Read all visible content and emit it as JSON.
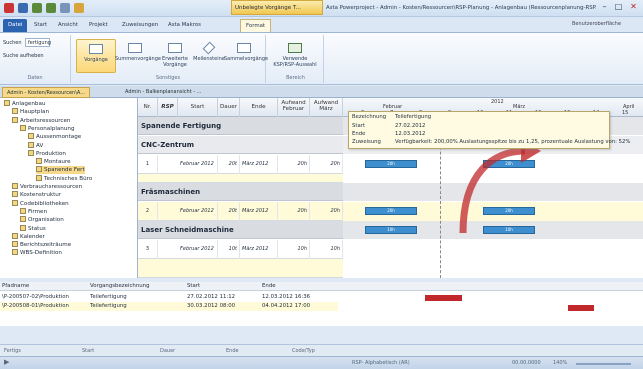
{
  "titlebar": {
    "context_label": "Unbelegte Vorgänge T...",
    "window_title": "Asta Powerproject - Admin - Kosten/Ressourcen\\RSP-Planung - Anlagenbau (Ressourcenplanung-RSP.pp) \\P..."
  },
  "tabs": [
    "Datei",
    "Start",
    "Ansicht",
    "Projekt",
    "Zuweisungen",
    "Asta Makros",
    "Format"
  ],
  "help_label": "Benutzeroberfläche",
  "ribbon": {
    "daten": {
      "search_label": "Suchen",
      "search_value": "fertigung",
      "clear": "Suche aufheben",
      "group": "Daten"
    },
    "buttons": [
      {
        "label": "Vorgänge",
        "sel": true
      },
      {
        "label": "Summenvorgänge"
      },
      {
        "label": "Erweiterte Vorgänge"
      },
      {
        "label": "Meilensteine"
      },
      {
        "label": "Sammelvorgänge"
      }
    ],
    "sonstiges_label": "Sonstiges",
    "bereich": {
      "label": "Verwende KSP/RSP-Auswahl",
      "group": "Bereich"
    }
  },
  "doc_tabs": [
    {
      "label": "Admin - Kosten/Ressourcen\\A...",
      "active": true
    },
    {
      "label": "Admin - Balkenplanansicht - ..."
    }
  ],
  "tree": [
    {
      "label": "Anlagenbau",
      "lvl": 0
    },
    {
      "label": "Hauptplan",
      "lvl": 1
    },
    {
      "label": "Arbeitsressourcen",
      "lvl": 1
    },
    {
      "label": "Personalplanung",
      "lvl": 2
    },
    {
      "label": "Aussenmontage",
      "lvl": 3
    },
    {
      "label": "AV",
      "lvl": 3
    },
    {
      "label": "Produktion",
      "lvl": 3
    },
    {
      "label": "Montaure",
      "lvl": 4
    },
    {
      "label": "Spanende Fert",
      "lvl": 4,
      "sel": true
    },
    {
      "label": "Technisches Büro",
      "lvl": 4
    },
    {
      "label": "Verbrauchsressourcen",
      "lvl": 1
    },
    {
      "label": "Kostenstruktur",
      "lvl": 1
    },
    {
      "label": "Codebibliotheken",
      "lvl": 1
    },
    {
      "label": "Firmen",
      "lvl": 2
    },
    {
      "label": "Organisation",
      "lvl": 2
    },
    {
      "label": "Status",
      "lvl": 2
    },
    {
      "label": "Kalender",
      "lvl": 1
    },
    {
      "label": "Berichtszeiträume",
      "lvl": 1
    },
    {
      "label": "WBS-Definition",
      "lvl": 1
    }
  ],
  "grid": {
    "headers": [
      "Nr.",
      "RSP",
      "Start",
      "Dauer",
      "Ende",
      "Aufwand Februar",
      "Aufwand März"
    ],
    "bands": [
      "Spanende Fertigung",
      "CNC-Zentrum",
      "Fräsmaschinen",
      "Laser Schneidmaschine"
    ],
    "rows": [
      {
        "nr": "1",
        "start": "Februar 2012",
        "dauer": "20t",
        "ende": "März 2012",
        "a1": "20h",
        "a2": "20h"
      },
      {
        "nr": "2",
        "start": "Februar 2012",
        "dauer": "20t",
        "ende": "März 2012",
        "a1": "20h",
        "a2": "20h"
      },
      {
        "nr": "3",
        "start": "Februar 2012",
        "dauer": "10t",
        "ende": "März 2012",
        "a1": "10h",
        "a2": "10h"
      }
    ]
  },
  "gantt": {
    "year": "2012",
    "months": [
      "Februar",
      "März",
      "April"
    ],
    "weeks": [
      "6",
      "7",
      "8",
      "9",
      "10",
      "11",
      "12",
      "13",
      "14",
      "15"
    ],
    "bars": [
      "20h",
      "20h",
      "20h",
      "20h",
      "10h",
      "10h"
    ]
  },
  "tooltip": {
    "keys": [
      "Bezeichnung",
      "Start",
      "Ende",
      "Zuweisung"
    ],
    "values": [
      "Teilefertigung",
      "27.02.2012",
      "12.03.2012",
      "Verfügbarkeit: 200,00%  Auslastungsspitze bis zu 1,25, prozentuale Auslastung von: 52%"
    ]
  },
  "bottom": {
    "headers": [
      "Pfadname",
      "Vorgangsbezeichnung",
      "Start",
      "Ende"
    ],
    "rows": [
      {
        "path": "\\P-200507-02\\Produktion",
        "name": "Teilefertigung",
        "start": "27.02.2012 11:12",
        "end": "12.03.2012 16:36"
      },
      {
        "path": "\\P-200508-01\\Produktion",
        "name": "Teilefertigung",
        "start": "30.03.2012 08:00",
        "end": "04.04.2012 17:00"
      }
    ]
  },
  "status1": [
    "Fertigs",
    "Start",
    "Dauer",
    "Ende",
    "Code/Typ"
  ],
  "status2": {
    "mode": "RSP- Alphabetisch (AR)",
    "date": "00.00.0000",
    "zoom": "140%"
  },
  "colors": {
    "accent": "#2c63b0",
    "bar": "#3d8fcf",
    "red": "#c0282b"
  }
}
